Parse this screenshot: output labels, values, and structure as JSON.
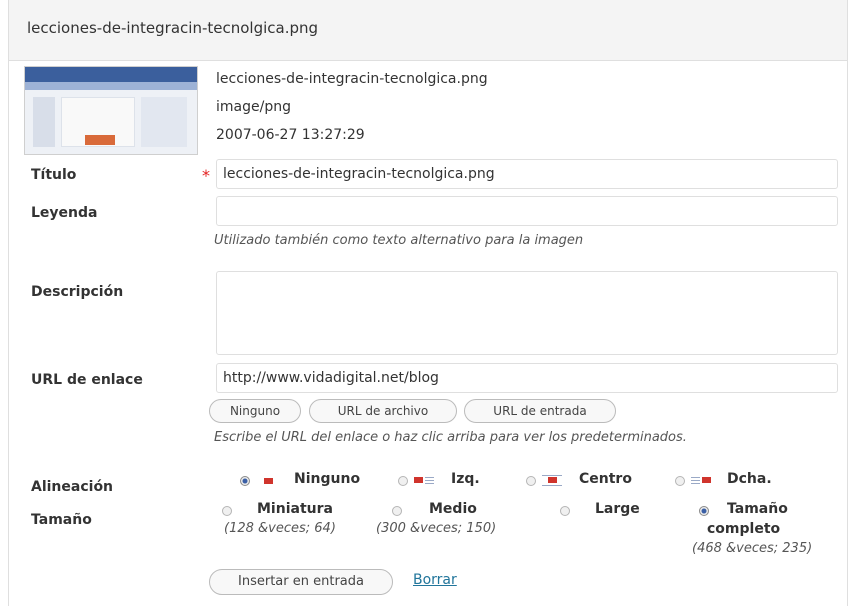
{
  "header": {
    "title": "lecciones-de-integracin-tecnolgica.png"
  },
  "file": {
    "name": "lecciones-de-integracin-tecnolgica.png",
    "mime": "image/png",
    "date": "2007-06-27 13:27:29"
  },
  "form": {
    "title_label": "Título",
    "title_value": "lecciones-de-integracin-tecnolgica.png",
    "caption_label": "Leyenda",
    "caption_value": "",
    "caption_help": "Utilizado también como texto alternativo para la imagen",
    "description_label": "Descripción",
    "description_value": "",
    "url_label": "URL de enlace",
    "url_value": "http://www.vidadigital.net/blog",
    "url_buttons": [
      "Ninguno",
      "URL de archivo",
      "URL de entrada"
    ],
    "url_help": "Escribe el URL del enlace o haz clic arriba para ver los predeterminados.",
    "alignment_label": "Alineación",
    "alignment_options": [
      "Ninguno",
      "Izq.",
      "Centro",
      "Dcha."
    ],
    "alignment_selected": "Ninguno",
    "size_label": "Tamaño",
    "size_options": [
      {
        "label": "Miniatura",
        "dims": "(128 &veces; 64)"
      },
      {
        "label": "Medio",
        "dims": "(300 &veces; 150)"
      },
      {
        "label": "Large",
        "dims": ""
      },
      {
        "label_line1": "Tamaño",
        "label_line2": "completo",
        "dims": "(468 &veces; 235)"
      }
    ],
    "size_selected": "Tamaño completo"
  },
  "actions": {
    "insert_label": "Insertar en entrada",
    "delete_label": "Borrar"
  },
  "colors": {
    "link": "#21759b",
    "required": "#e42020",
    "align_icon": "#d0342c",
    "radio_selected": "#3a5fa5"
  }
}
